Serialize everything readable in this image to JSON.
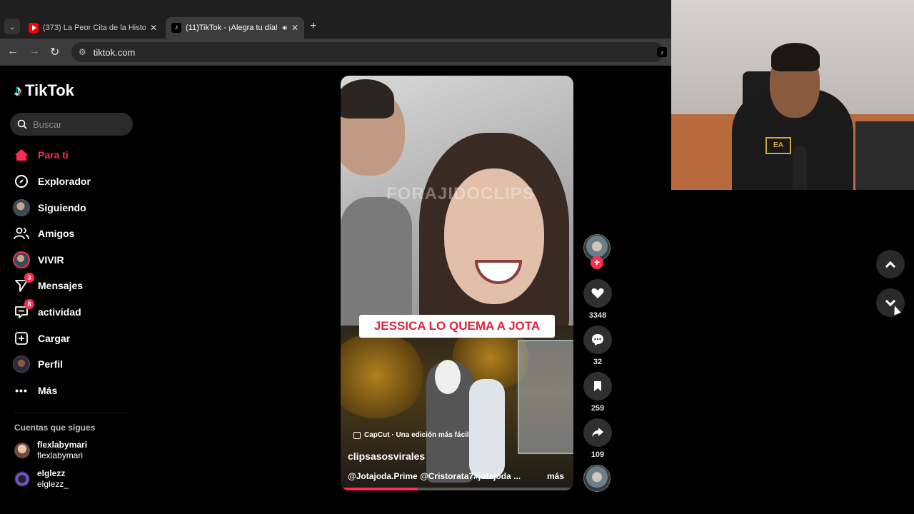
{
  "browser": {
    "tabs": [
      {
        "title": "(373) La Peor Cita de la Historia",
        "icon": "youtube-icon",
        "active": false
      },
      {
        "title": "(11)TikTok - ¡Alegra tu día!",
        "icon": "tiktok-icon",
        "active": true
      }
    ],
    "url": "tiktok.com"
  },
  "sidebar": {
    "logo": "TikTok",
    "search_placeholder": "Buscar",
    "nav": [
      {
        "label": "Para ti",
        "icon": "home-icon",
        "active": true
      },
      {
        "label": "Explorador",
        "icon": "compass-icon"
      },
      {
        "label": "Siguiendo",
        "icon": "following-avatar-icon"
      },
      {
        "label": "Amigos",
        "icon": "friends-icon"
      },
      {
        "label": "VIVIR",
        "icon": "live-avatar-icon"
      },
      {
        "label": "Mensajes",
        "icon": "messages-icon",
        "badge": "3"
      },
      {
        "label": "actividad",
        "icon": "activity-icon",
        "badge": "8"
      },
      {
        "label": "Cargar",
        "icon": "upload-icon"
      },
      {
        "label": "Perfil",
        "icon": "profile-avatar-icon"
      },
      {
        "label": "Más",
        "icon": "more-icon"
      }
    ],
    "following_title": "Cuentas que sigues",
    "following": [
      {
        "name": "flexlabymari",
        "handle": "flexlabymari"
      },
      {
        "name": "elglezz",
        "handle": "elglezz_"
      }
    ]
  },
  "video": {
    "watermark": "FORAJIDOCLIPS",
    "caption": "JESSICA LO QUEMA A JOTA",
    "capcut": "CapCut · Una edición más fácil",
    "author": "clipsasosvirales",
    "description": "@Jotajoda.Prime @Cristorata7#jotajoda ...",
    "more": "más",
    "progress": 0.33
  },
  "actions": {
    "likes": "3348",
    "comments": "32",
    "saves": "259",
    "shares": "109"
  },
  "colors": {
    "brand": "#fe2c55",
    "background": "#000000"
  }
}
